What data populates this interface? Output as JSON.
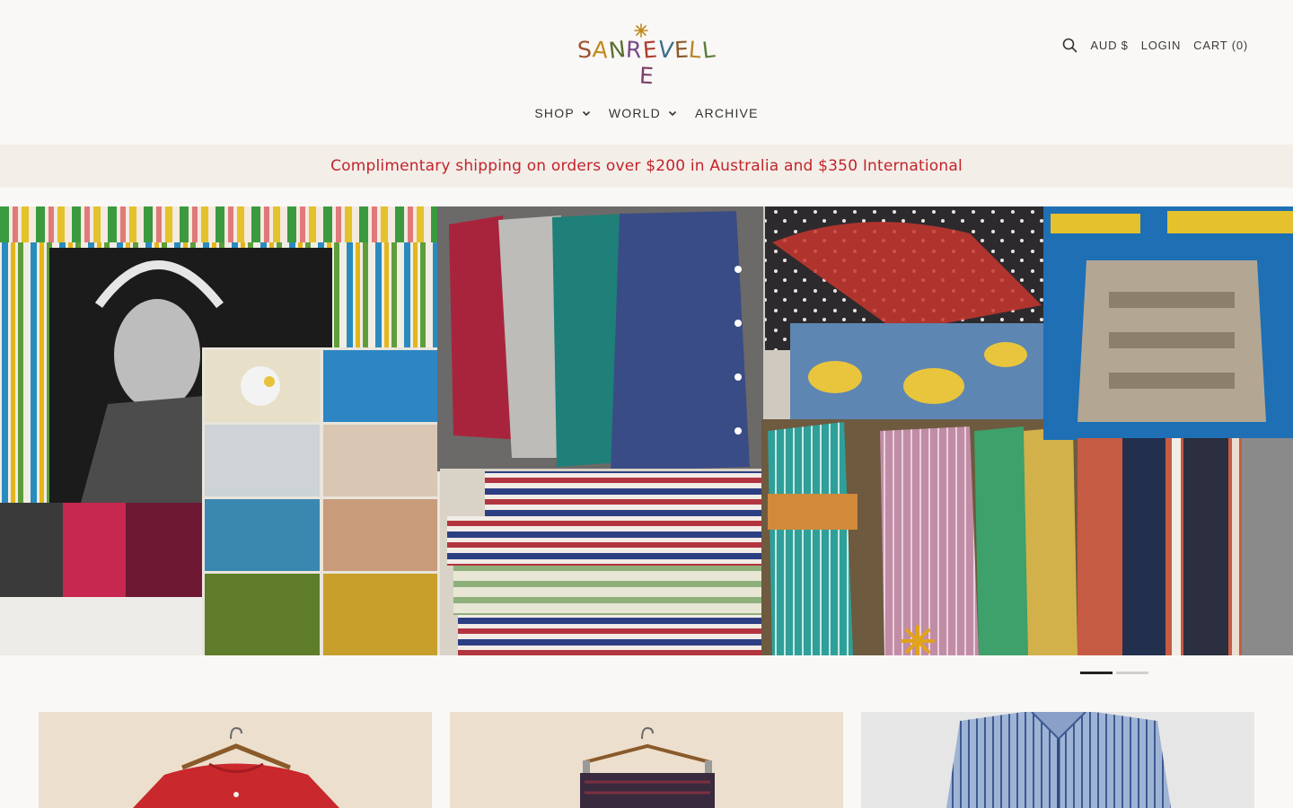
{
  "brand": {
    "logo_text": "SANREVELLE",
    "letters": [
      "S",
      "A",
      "N",
      "R",
      "E",
      "V",
      "E",
      "L",
      "L",
      "E"
    ],
    "letter_colors": [
      "#a0522d",
      "#c08a1e",
      "#5a6e2f",
      "#7a4a8a",
      "#b03a2e",
      "#3d6e8a",
      "#8a5a2b",
      "#b8872a",
      "#5b7f3a",
      "#7d3f6b"
    ],
    "accent": "#c4232b"
  },
  "header": {
    "search_icon": "search-icon",
    "currency": "AUD $",
    "login": "LOGIN",
    "cart": "CART (0)"
  },
  "nav": {
    "items": [
      {
        "label": "SHOP",
        "has_dropdown": true
      },
      {
        "label": "WORLD",
        "has_dropdown": true
      },
      {
        "label": "ARCHIVE",
        "has_dropdown": false
      }
    ]
  },
  "announcement": {
    "text": "Complimentary shipping on orders over $200 in Australia and $350 International"
  },
  "hero": {
    "slides_total": 2,
    "active_slide": 1
  },
  "products": [
    {
      "image": "red-blouse-on-hanger"
    },
    {
      "image": "printed-skirt-on-hanger"
    },
    {
      "image": "blue-striped-shirt"
    }
  ]
}
